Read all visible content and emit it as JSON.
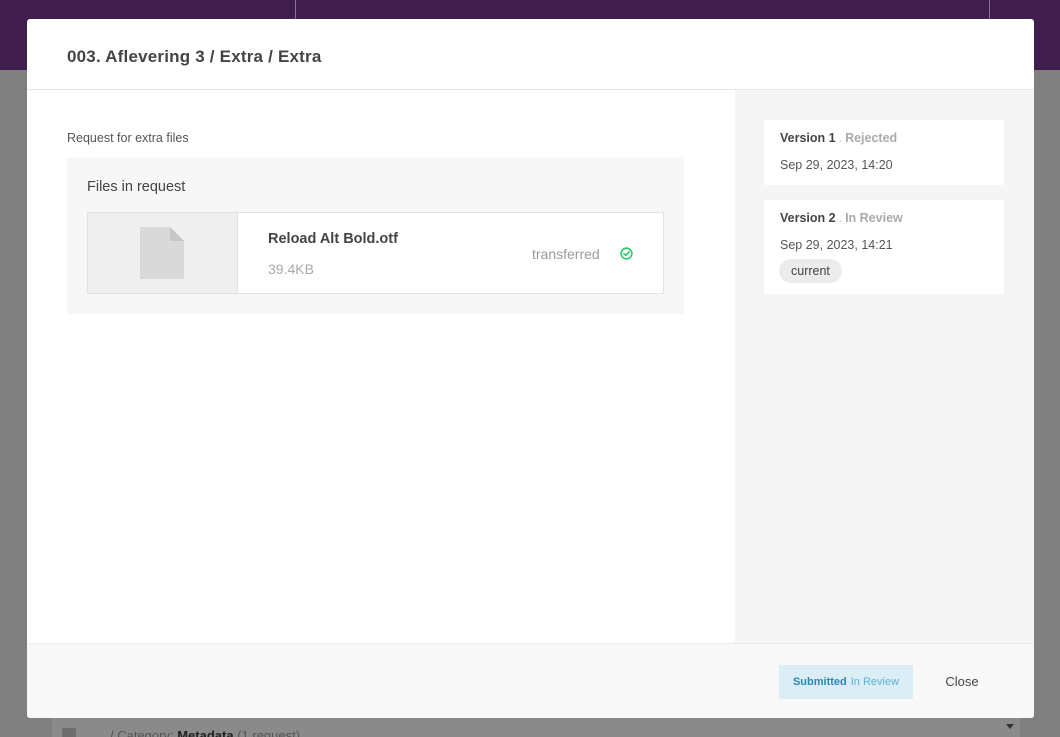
{
  "modal": {
    "title": "003. Aflevering 3 / Extra / Extra",
    "request_label": "Request for extra files",
    "files_title": "Files in request",
    "file": {
      "name": "Reload Alt Bold.otf",
      "size": "39.4KB",
      "status": "transferred",
      "status_icon": "check-circle-icon",
      "status_color": "#2ecc71"
    },
    "versions": [
      {
        "label": "Version 1",
        "status": "Rejected",
        "date": "Sep 29, 2023, 14:20"
      },
      {
        "label": "Version 2",
        "status": "In Review",
        "date": "Sep 29, 2023, 14:21",
        "badge": "current"
      }
    ],
    "footer": {
      "status_primary": "Submitted",
      "status_secondary": "In Review",
      "close_label": "Close"
    }
  },
  "background": {
    "row_prefix": "/ Category:",
    "row_name": "Metadata",
    "row_count": "(1 request)"
  }
}
